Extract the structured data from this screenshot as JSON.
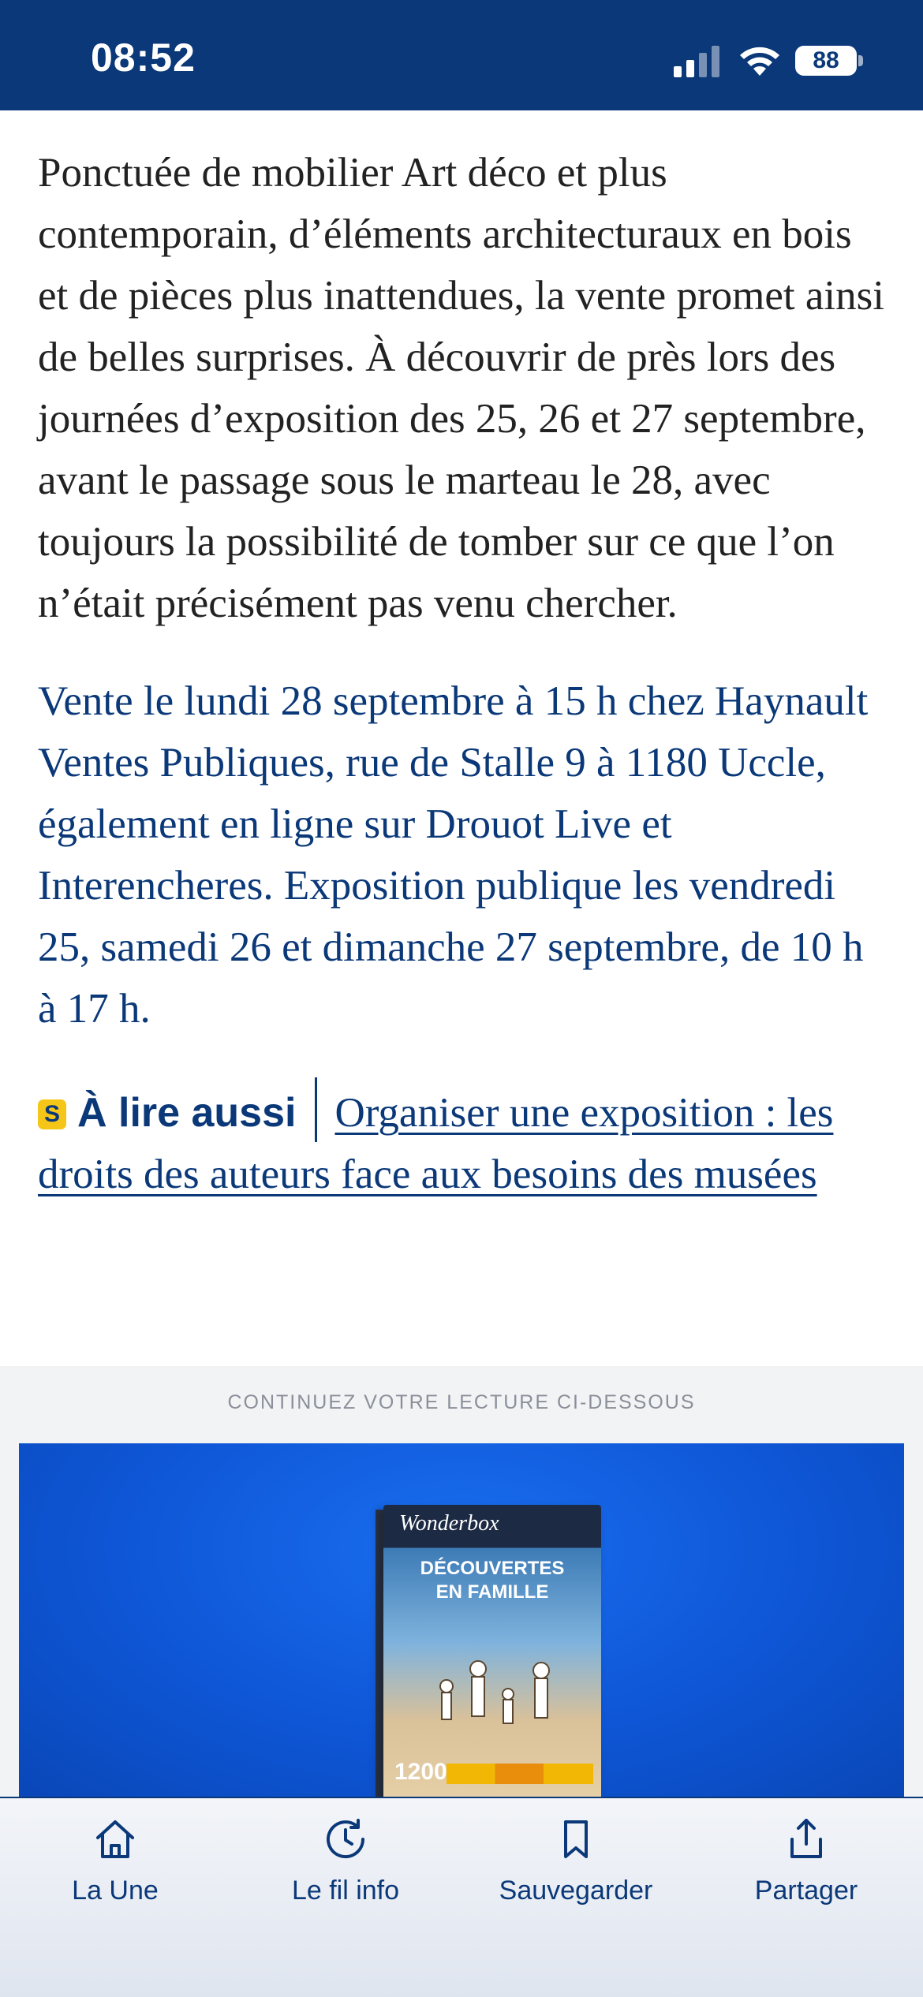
{
  "status_bar": {
    "time": "08:52",
    "battery": "88",
    "signal_icon": "cellular-signal-icon",
    "wifi_icon": "wifi-icon",
    "background": "#0a3878"
  },
  "article": {
    "paragraph_1": "Ponctuée de mobilier Art déco et plus contemporain, d’éléments architecturaux en bois et de pièces plus inattendues, la vente promet ainsi de belles surprises. À découvrir de près lors des journées d’exposition des 25, 26 et 27 septembre, avant le passage sous le marteau le 28, avec toujours la possibilité de tomber sur ce que l’on n’était précisément pas venu chercher.",
    "paragraph_info": "Vente le lundi 28 septembre à 15 h chez Haynault Ventes Publiques, rue de Stalle 9 à 1180 Uccle, également en ligne sur Drouot Live et Interencheres. Exposition publique les vendredi 25, samedi 26 et dimanche 27 septembre, de 10 h à 17 h.",
    "read_also": {
      "badge": "S",
      "label": "À lire aussi",
      "link_text": "Organiser une exposition : les droits des auteurs face aux besoins des musées"
    }
  },
  "continue_section": {
    "label": "CONTINUEZ VOTRE LECTURE CI-DESSOUS",
    "ad": {
      "brand": "Wonderbox",
      "title_line_1": "DÉCOUVERTES",
      "title_line_2": "EN FAMILLE",
      "count": "1200"
    }
  },
  "tab_bar": {
    "tabs": [
      {
        "label": "La Une",
        "icon": "home-icon"
      },
      {
        "label": "Le fil info",
        "icon": "clock-history-icon"
      },
      {
        "label": "Sauvegarder",
        "icon": "bookmark-icon"
      },
      {
        "label": "Partager",
        "icon": "share-icon"
      }
    ],
    "accent": "#0a3878"
  }
}
